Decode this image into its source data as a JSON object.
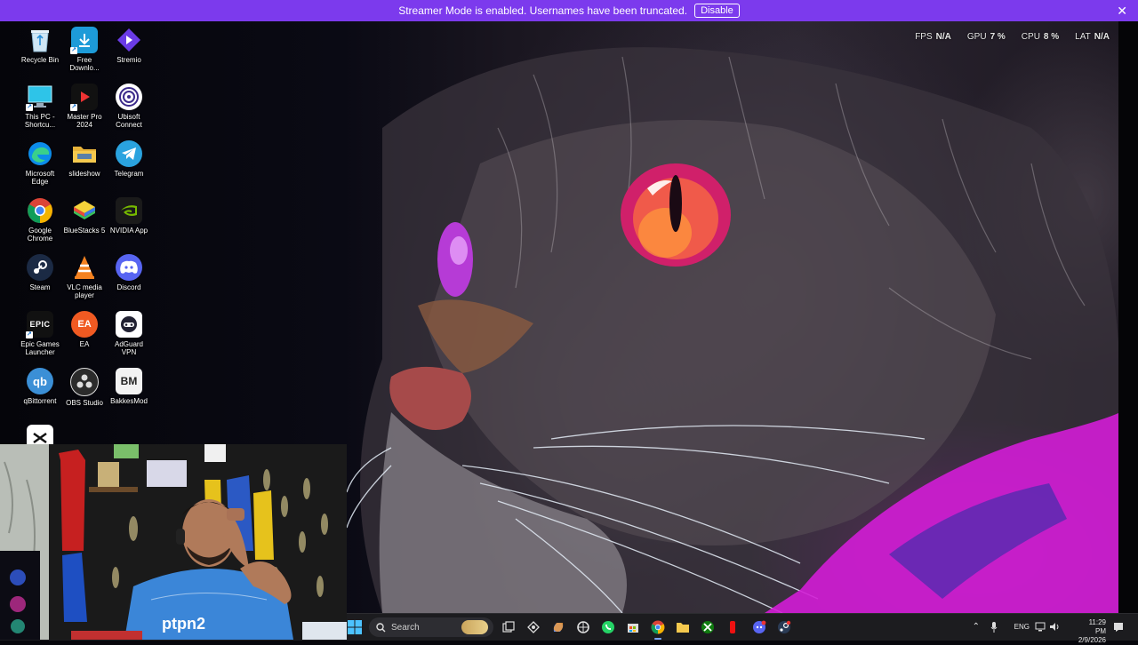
{
  "banner": {
    "message": "Streamer Mode is enabled. Usernames have been truncated.",
    "disable_label": "Disable",
    "close_icon": "close-icon",
    "color": "#7c3aed"
  },
  "perf": {
    "fps_label": "FPS",
    "fps_value": "N/A",
    "gpu_label": "GPU",
    "gpu_value": "7 %",
    "cpu_label": "CPU",
    "cpu_value": "8 %",
    "lat_label": "LAT",
    "lat_value": "N/A"
  },
  "desktop": {
    "icons": [
      {
        "label": "Recycle Bin",
        "icon": "recycle-bin-icon"
      },
      {
        "label": "Free Downlo...",
        "icon": "free-download-manager-icon"
      },
      {
        "label": "Stremio",
        "icon": "stremio-icon"
      },
      {
        "label": "This PC - Shortcu...",
        "icon": "this-pc-icon"
      },
      {
        "label": "Master Pro 2024",
        "icon": "master-pro-icon"
      },
      {
        "label": "Ubisoft Connect",
        "icon": "ubisoft-connect-icon"
      },
      {
        "label": "Microsoft Edge",
        "icon": "edge-icon"
      },
      {
        "label": "slideshow",
        "icon": "folder-icon"
      },
      {
        "label": "Telegram",
        "icon": "telegram-icon"
      },
      {
        "label": "Google Chrome",
        "icon": "chrome-icon"
      },
      {
        "label": "BlueStacks 5",
        "icon": "bluestacks-icon"
      },
      {
        "label": "NVIDIA App",
        "icon": "nvidia-icon"
      },
      {
        "label": "Steam",
        "icon": "steam-icon"
      },
      {
        "label": "VLC media player",
        "icon": "vlc-icon"
      },
      {
        "label": "Discord",
        "icon": "discord-icon"
      },
      {
        "label": "Epic Games Launcher",
        "icon": "epic-games-icon"
      },
      {
        "label": "EA",
        "icon": "ea-icon"
      },
      {
        "label": "AdGuard VPN",
        "icon": "adguard-vpn-icon"
      },
      {
        "label": "qBittorrent",
        "icon": "qbittorrent-icon"
      },
      {
        "label": "OBS Studio",
        "icon": "obs-icon"
      },
      {
        "label": "BakkesMod",
        "icon": "bakkesmod-icon"
      },
      {
        "label": "",
        "icon": "capcut-icon"
      }
    ],
    "glyphs": {
      "epic": "EPIC",
      "ea": "EA",
      "qb": "qb",
      "bm": "BM"
    }
  },
  "webcam": {
    "shirt_text": "ptpn2"
  },
  "taskbar": {
    "search_placeholder": "Search",
    "apps": [
      {
        "name": "task-view-icon"
      },
      {
        "name": "widgets-icon"
      },
      {
        "name": "copilot-icon"
      },
      {
        "name": "chatgpt-icon"
      },
      {
        "name": "whatsapp-icon"
      },
      {
        "name": "store-icon"
      },
      {
        "name": "chrome-icon"
      },
      {
        "name": "file-explorer-icon"
      },
      {
        "name": "xbox-icon"
      },
      {
        "name": "red-app-icon"
      },
      {
        "name": "discord-icon"
      },
      {
        "name": "steam-icon"
      }
    ],
    "tray": {
      "language": "ENG",
      "time": "11:29 PM",
      "date": "2/9/2026"
    }
  }
}
